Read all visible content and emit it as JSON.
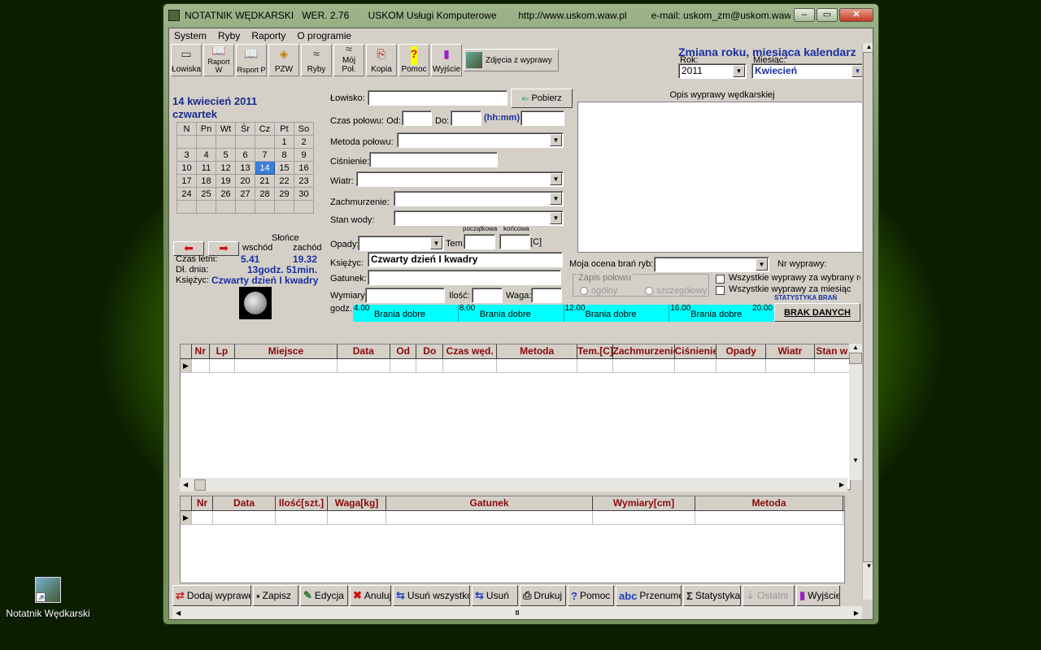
{
  "desktop": {
    "icon_label": "Notatnik Wędkarski"
  },
  "window": {
    "title": "NOTATNIK WĘDKARSKI   WER. 2.76       USKOM Usługi Komputerowe        http://www.uskom.waw.pl         e-mail: uskom_zm@uskom.waw.pl"
  },
  "menu": [
    "System",
    "Ryby",
    "Raporty",
    "O programie"
  ],
  "toolbar": [
    {
      "label": "Łowiska",
      "icon": "▭"
    },
    {
      "label": "Raport W",
      "icon": "📖"
    },
    {
      "label": "Rsport P",
      "icon": "📖"
    },
    {
      "label": "PZW",
      "icon": "◈"
    },
    {
      "label": "Ryby",
      "icon": "≈"
    },
    {
      "label": "Mój Poł.",
      "icon": "≈"
    },
    {
      "label": "Kopia",
      "icon": "⎘"
    },
    {
      "label": "Pomoc",
      "icon": "?"
    },
    {
      "label": "Wyjście",
      "icon": "▮"
    }
  ],
  "photos_button": "Zdjęcia z wyprawy",
  "calendar_change": {
    "title": "Zmiana roku, miesiąca kalendarz",
    "year_label": "Rok:",
    "year": "2011",
    "month_label": "Miesiąc:",
    "month": "Kwiecień"
  },
  "calendar": {
    "date": "14 kwiecień 2011",
    "weekday": "czwartek",
    "headers": [
      "N",
      "Pn",
      "Wt",
      "Śr",
      "Cz",
      "Pt",
      "So"
    ],
    "rows": [
      [
        "",
        "",
        "",
        "",
        "",
        "1",
        "2"
      ],
      [
        "3",
        "4",
        "5",
        "6",
        "7",
        "8",
        "9"
      ],
      [
        "10",
        "11",
        "12",
        "13",
        "14",
        "15",
        "16"
      ],
      [
        "17",
        "18",
        "19",
        "20",
        "21",
        "22",
        "23"
      ],
      [
        "24",
        "25",
        "26",
        "27",
        "28",
        "29",
        "30"
      ],
      [
        "",
        "",
        "",
        "",
        "",
        "",
        ""
      ]
    ],
    "selected": "14"
  },
  "sun": {
    "title": "Słońce",
    "sunrise_label": "wschód",
    "sunset_label": "zachód",
    "summer_label": "Czas letni:",
    "sunrise": "5.41",
    "sunset": "19.32",
    "day_label": "Dł. dnia:",
    "day_length": "13godz. 51min.",
    "moon_label": "Księżyc:",
    "moon_phase": "Czwarty dzień I kwadry"
  },
  "form": {
    "fishery_label": "Łowisko:",
    "fetch_button": "Pobierz",
    "time_label": "Czas połowu: Od:",
    "to_label": "Do:",
    "hhmm": "(hh:mm)",
    "method_label": "Metoda połowu:",
    "pressure_label": "Ciśnienie:",
    "wind_label": "Wiatr:",
    "clouds_label": "Zachmurzenie:",
    "water_label": "Stan wody:",
    "rain_label": "Opady:",
    "temp_label": "Tem.",
    "temp_start": "początkowa",
    "temp_end": "końcowa",
    "temp_unit": "[C]",
    "moon_label": "Księżyc:",
    "moon_value": "Czwarty dzień I kwadry",
    "species_label": "Gatunek:",
    "size_label": "Wymiary:",
    "qty_label": "Ilość:",
    "weight_label": "Waga:",
    "hours_label": "godz."
  },
  "notes_title": "Opis wyprawy wędkarskiej",
  "rating": {
    "label": "Moja ocena brań ryb:",
    "trip_no_label": "Nr wyprawy:",
    "mode_title": "Zapis połowu",
    "mode_general": "ogólny",
    "mode_detailed": "szczegółowy",
    "chk_year": "Wszystkie wyprawy za wybrany rok",
    "chk_month": "Wszystkie wyprawy za miesiąc",
    "stats": "STATYSTYKA BRAŃ",
    "no_data": "BRAK DANYCH"
  },
  "bites": [
    {
      "hour": "4.00",
      "text": "Brania dobre"
    },
    {
      "hour": "8.00",
      "text": "Brania dobre"
    },
    {
      "hour": "12.00",
      "text": "Brania dobre"
    },
    {
      "hour": "16.00",
      "text": "Brania dobre"
    }
  ],
  "bites_end": "20.00",
  "trips_table": {
    "columns": [
      "Nr",
      "Lp",
      "Miejsce",
      "Data",
      "Od",
      "Do",
      "Czas  węd.",
      "Metoda",
      "Tem.[C]",
      "Zachmurzenie",
      "Ciśnienie",
      "Opady",
      "Wiatr",
      "Stan w"
    ]
  },
  "catch_table": {
    "columns": [
      "Nr",
      "Data",
      "Ilość[szt.]",
      "Waga[kg]",
      "Gatunek",
      "Wymiary[cm]",
      "Metoda"
    ]
  },
  "bottom": [
    {
      "label": "Dodaj wyprawę",
      "icon": "⇄"
    },
    {
      "label": "Zapisz",
      "icon": "▪"
    },
    {
      "label": "Edycja",
      "icon": "✎"
    },
    {
      "label": "Anuluj",
      "icon": "✖"
    },
    {
      "label": "Usuń wszystko",
      "icon": "⇆"
    },
    {
      "label": "Usuń",
      "icon": "⇆"
    },
    {
      "label": "Drukuj",
      "icon": "⎙"
    },
    {
      "label": "Pomoc",
      "icon": "?"
    },
    {
      "label": "Przenumeruj",
      "icon": "abc"
    },
    {
      "label": "Statystyka",
      "icon": "Σ"
    },
    {
      "label": "Ostatni",
      "icon": "⇣"
    },
    {
      "label": "Wyjście",
      "icon": "▮"
    }
  ],
  "colors": {
    "accent": "#1a2fa0",
    "header_text": "#8a0a0a",
    "bites_bg": "#00ffff"
  }
}
